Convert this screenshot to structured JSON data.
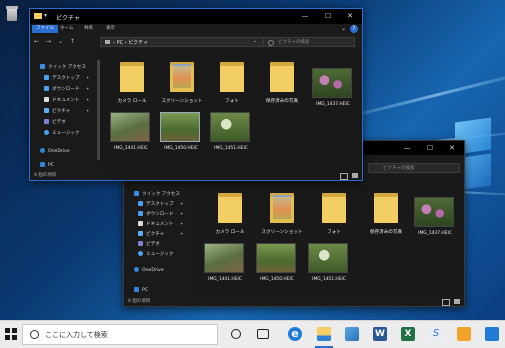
{
  "taskbar": {
    "search_placeholder": "ここに入力して検索"
  },
  "windows": [
    {
      "title": "ピクチャ",
      "tabs": [
        "ファイル",
        "ホーム",
        "共有",
        "表示"
      ],
      "path": [
        "PC",
        "ピクチャ"
      ],
      "search_placeholder": "ピクチャの検索",
      "nav": {
        "quick_access": "クイック アクセス",
        "items": [
          "デスクトップ",
          "ダウンロード",
          "ドキュメント",
          "ピクチャ",
          "ビデオ",
          "ミュージック"
        ],
        "onedrive": "OneDrive",
        "pc": "PC"
      },
      "files": [
        "カメラ ロール",
        "スクリーンショット",
        "フォト",
        "保存済みの写真",
        "IMG_1437.HEIC",
        "IMG_1441.HEIC",
        "IMG_1450.HEIC",
        "IMG_1451.HEIC"
      ],
      "status": "8 個の項目"
    },
    {
      "search_placeholder": "ピクチャの検索",
      "nav": {
        "quick_access": "クイック アクセス",
        "items": [
          "デスクトップ",
          "ダウンロード",
          "ドキュメント",
          "ピクチャ",
          "ビデオ",
          "ミュージック"
        ],
        "onedrive": "OneDrive",
        "pc": "PC"
      },
      "files": [
        "カメラ ロール",
        "スクリーンショット",
        "フォト",
        "保存済みの写真",
        "IMG_1437.HEIC",
        "IMG_1441.HEIC",
        "IMG_1450.HEIC",
        "IMG_1451.HEIC"
      ],
      "status": "8 個の項目"
    }
  ],
  "colors": {
    "accent": "#2b6ed1",
    "folder": "#f3cf63",
    "taskbar": "#ececec"
  }
}
